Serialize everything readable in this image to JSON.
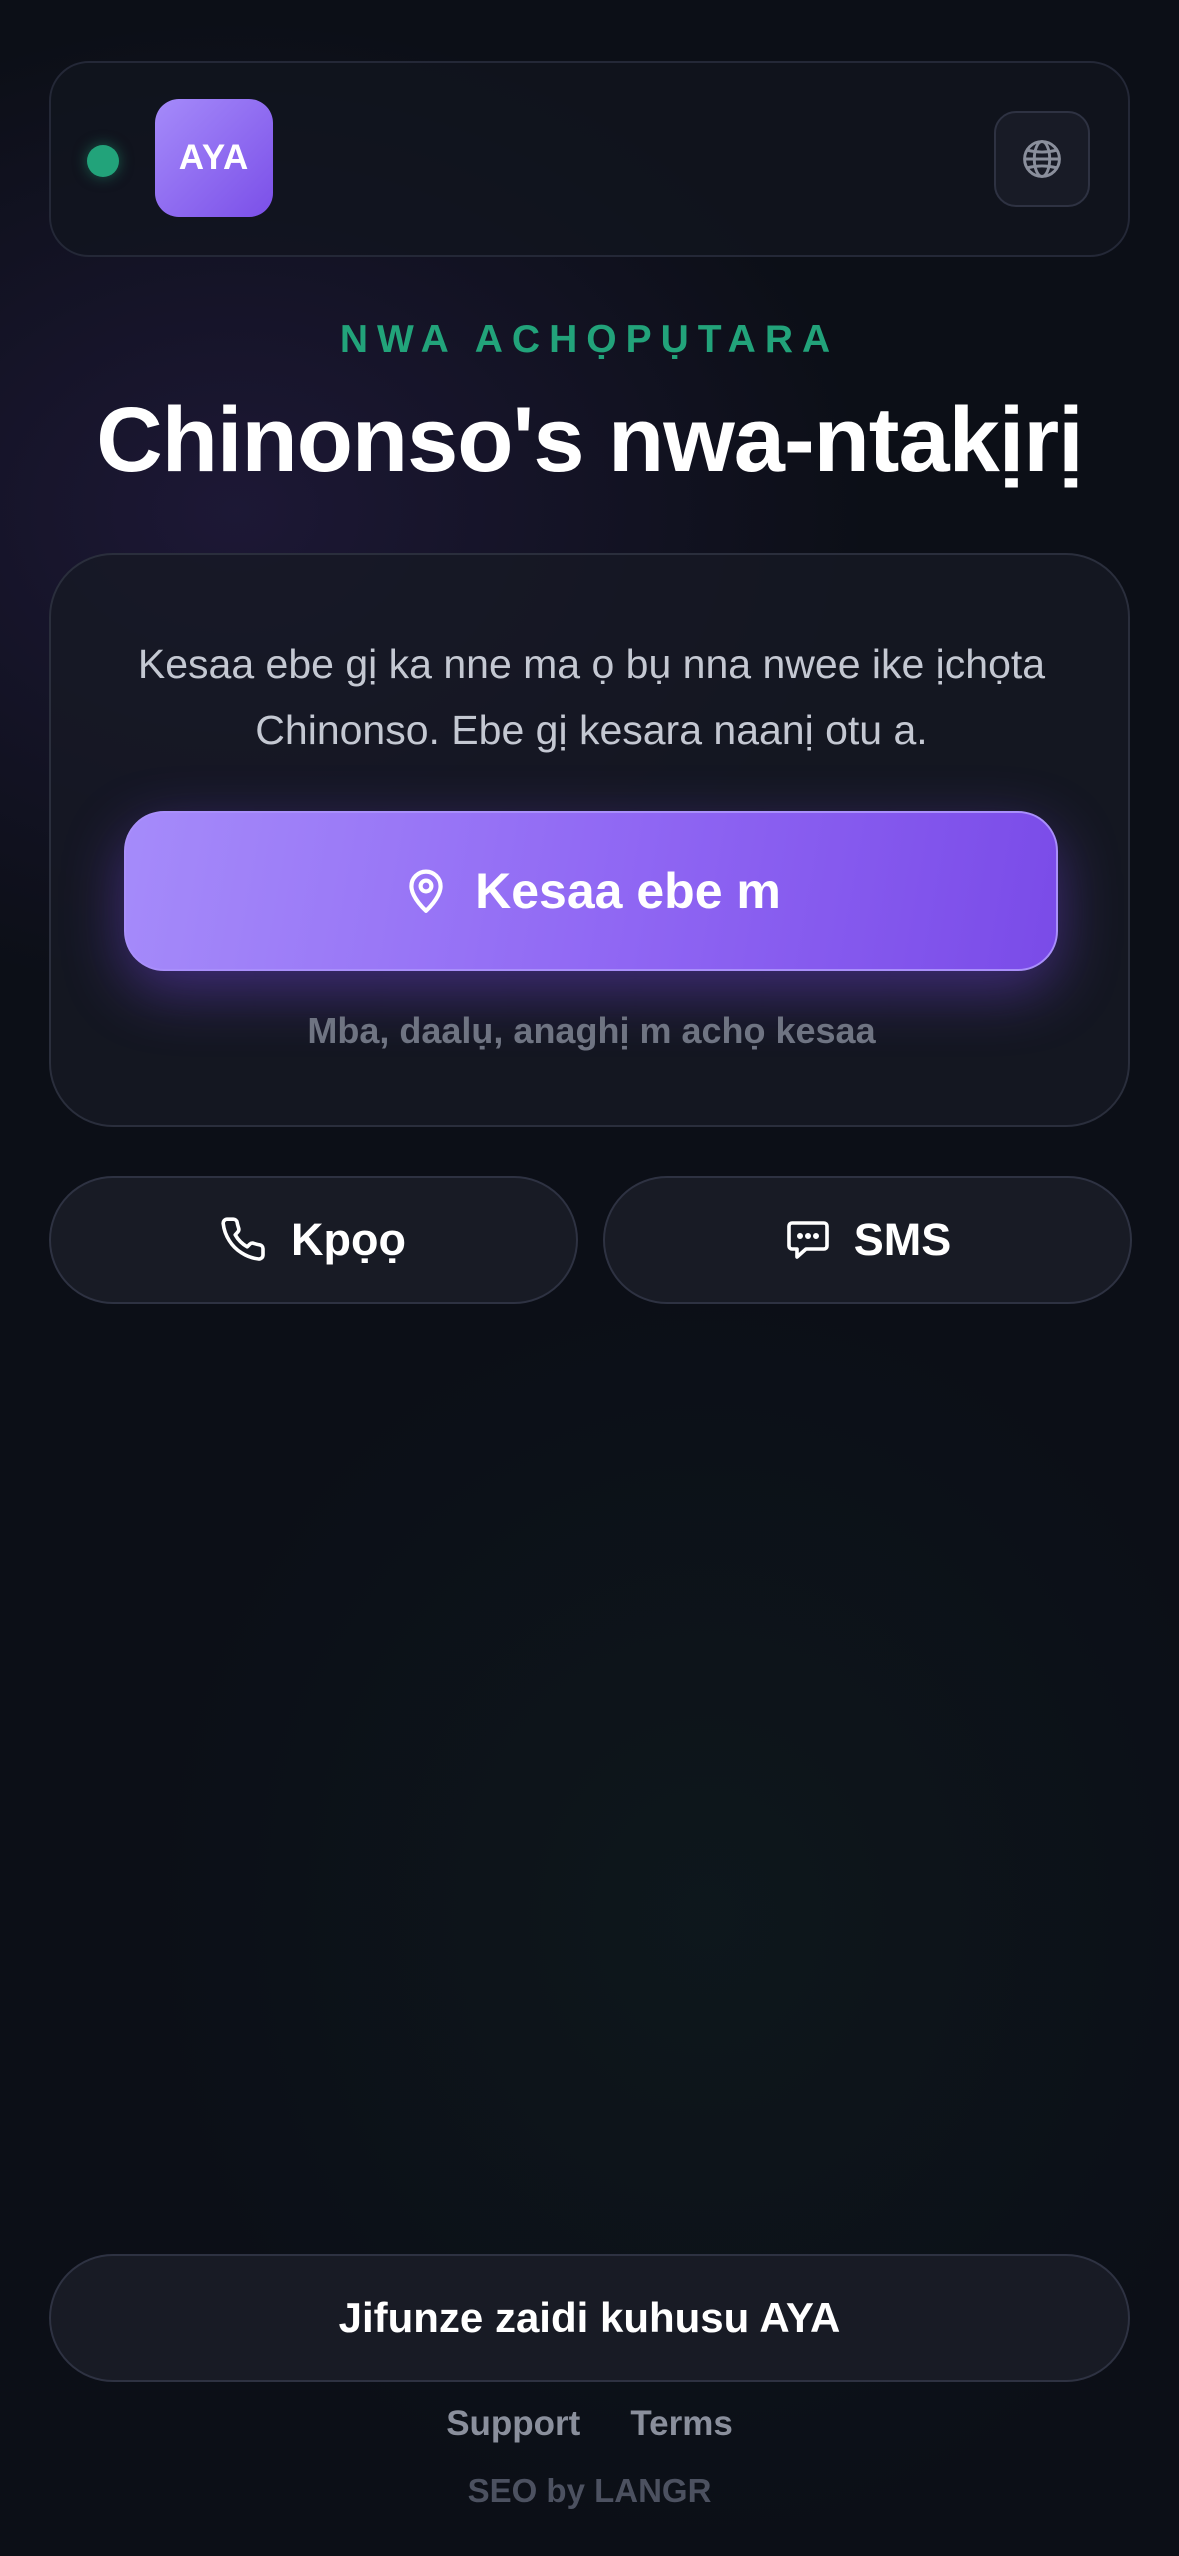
{
  "header": {
    "logo_text": "AYA",
    "status_color": "#22a37a",
    "language_icon": "globe-icon"
  },
  "hero": {
    "eyebrow": "NWA ACHỌPỤTARA",
    "title": "Chinonso's nwa-ntakịrị"
  },
  "card": {
    "description": "Kesaa ebe gị ka nne ma ọ bụ nna nwee ike ịchọta Chinonso. Ebe gị kesara naanị otu a.",
    "primary_button": {
      "label": "Kesaa ebe m",
      "icon": "location-pin-icon"
    },
    "decline_text": "Mba, daalụ, anaghị m achọ kesaa"
  },
  "actions": {
    "call": {
      "label": "Kpọọ",
      "icon": "phone-icon"
    },
    "sms": {
      "label": "SMS",
      "icon": "chat-bubble-icon"
    }
  },
  "footer": {
    "learn_more": "Jifunze zaidi kuhusu AYA",
    "links": [
      "Support",
      "Terms"
    ],
    "credit": "SEO by LANGR"
  },
  "colors": {
    "accent_purple": "#8f66f3",
    "accent_green": "#22a37a",
    "background": "#0c0f17"
  }
}
